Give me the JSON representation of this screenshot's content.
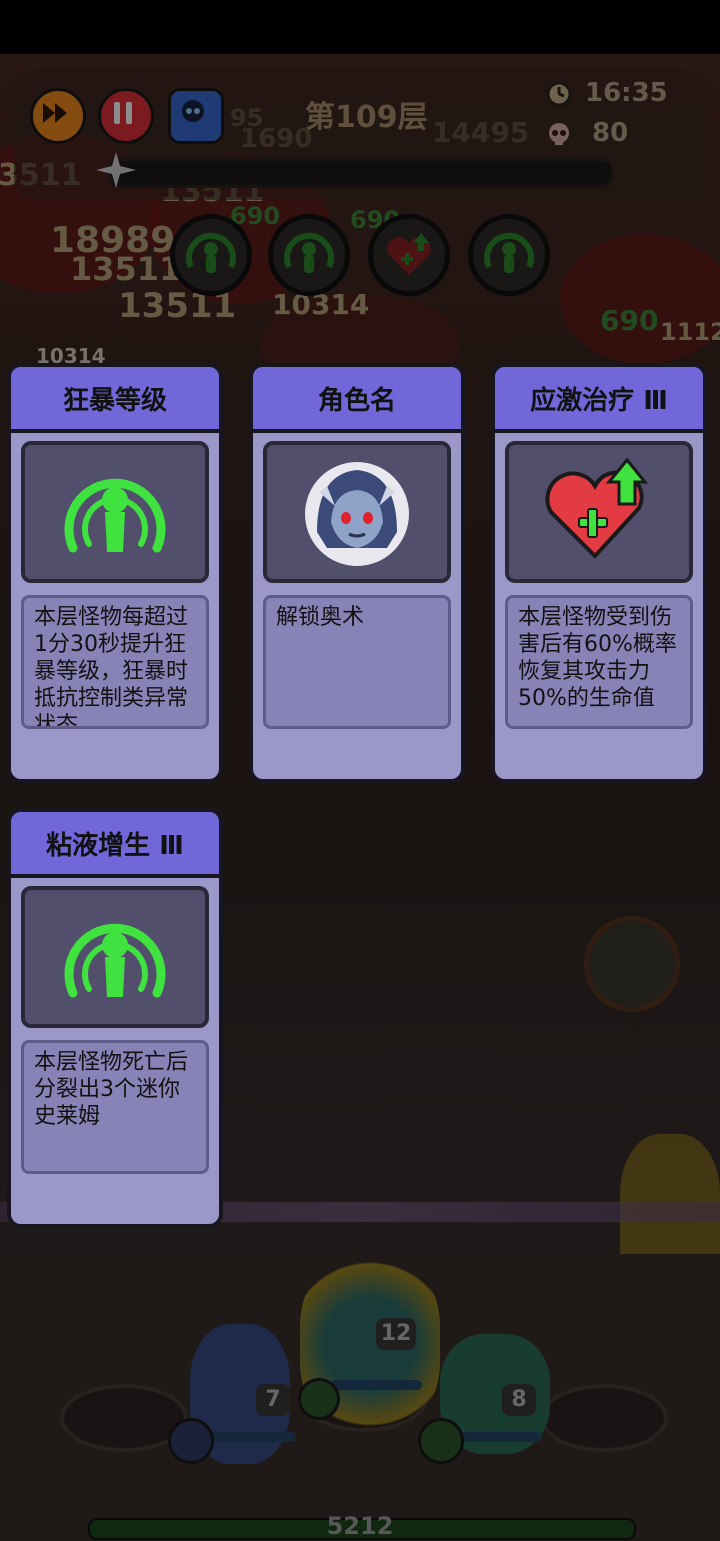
{
  "hud": {
    "floor_label": "第109层",
    "time": "16:35",
    "kill_count": "80",
    "team_hp": "5212"
  },
  "damage_numbers": [
    "18989",
    "13511",
    "13511",
    "13511",
    "10314",
    "14495",
    "690",
    "690",
    "690",
    "1690",
    "95",
    "10314",
    "1112",
    "3511"
  ],
  "cards": [
    {
      "title": "狂暴等级",
      "icon": "green-slime-emblem-icon",
      "desc": "本层怪物每超过1分30秒提升狂暴等级，狂暴时抵抗控制类异常状态"
    },
    {
      "title": "角色名",
      "icon": "hooded-character-portrait",
      "desc": "解锁奥术"
    },
    {
      "title": "应激治疗 Ⅲ",
      "icon": "heart-heal-up-icon",
      "desc": "本层怪物受到伤害后有60%概率恢复其攻击力50%的生命值"
    },
    {
      "title": "粘液增生 Ⅲ",
      "icon": "green-slime-emblem-icon",
      "desc": "本层怪物死亡后分裂出3个迷你史莱姆"
    }
  ],
  "heroes": [
    {
      "level": "7"
    },
    {
      "level": "12"
    },
    {
      "level": "8"
    }
  ],
  "colors": {
    "card_header": "#7167d8",
    "card_body": "#9b98c9",
    "slime_green": "#3fe23f",
    "heart_red": "#e23b44"
  }
}
